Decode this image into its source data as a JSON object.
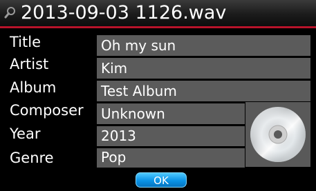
{
  "header": {
    "filename": "2013-09-03 1126.wav",
    "icon": "search-icon"
  },
  "tags": [
    {
      "label": "Title",
      "value": "Oh my sun"
    },
    {
      "label": "Artist",
      "value": "Kim"
    },
    {
      "label": "Album",
      "value": "Test Album"
    },
    {
      "label": "Composer",
      "value": "Unknown"
    },
    {
      "label": "Year",
      "value": "2013"
    },
    {
      "label": "Genre",
      "value": "Pop"
    }
  ],
  "album_art": {
    "icon": "cd-disc-icon"
  },
  "ok_label": "OK",
  "colors": {
    "accent_line": "#b8132a",
    "field_bg": "#5b5b5b",
    "button": "#0a93e6"
  }
}
